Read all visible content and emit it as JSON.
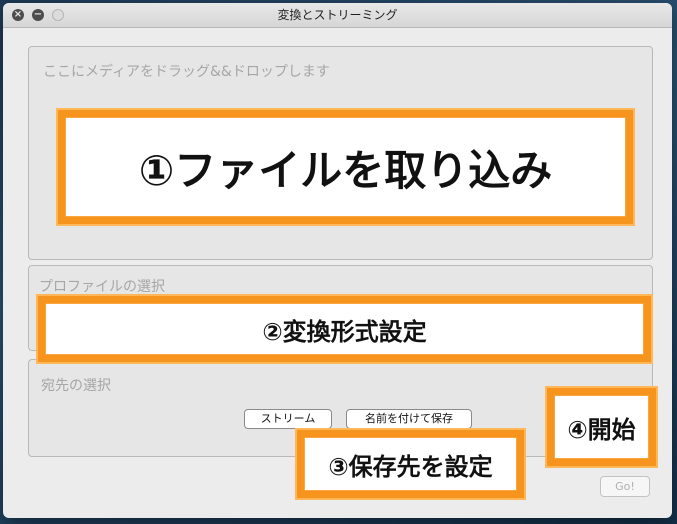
{
  "window": {
    "title": "変換とストリーミング"
  },
  "drop_area": {
    "hint": "ここにメディアをドラッグ&&ドロップします"
  },
  "profile_section": {
    "label": "プロファイルの選択"
  },
  "destination_section": {
    "label": "宛先の選択",
    "stream_button": "ストリーム",
    "save_as_button": "名前を付けて保存"
  },
  "actions": {
    "go_button": "Go!"
  },
  "annotations": {
    "step1": "①ファイルを取り込み",
    "step2": "②変換形式設定",
    "step3": "③保存先を設定",
    "step4": "④開始",
    "border_color": "#f7941d"
  }
}
